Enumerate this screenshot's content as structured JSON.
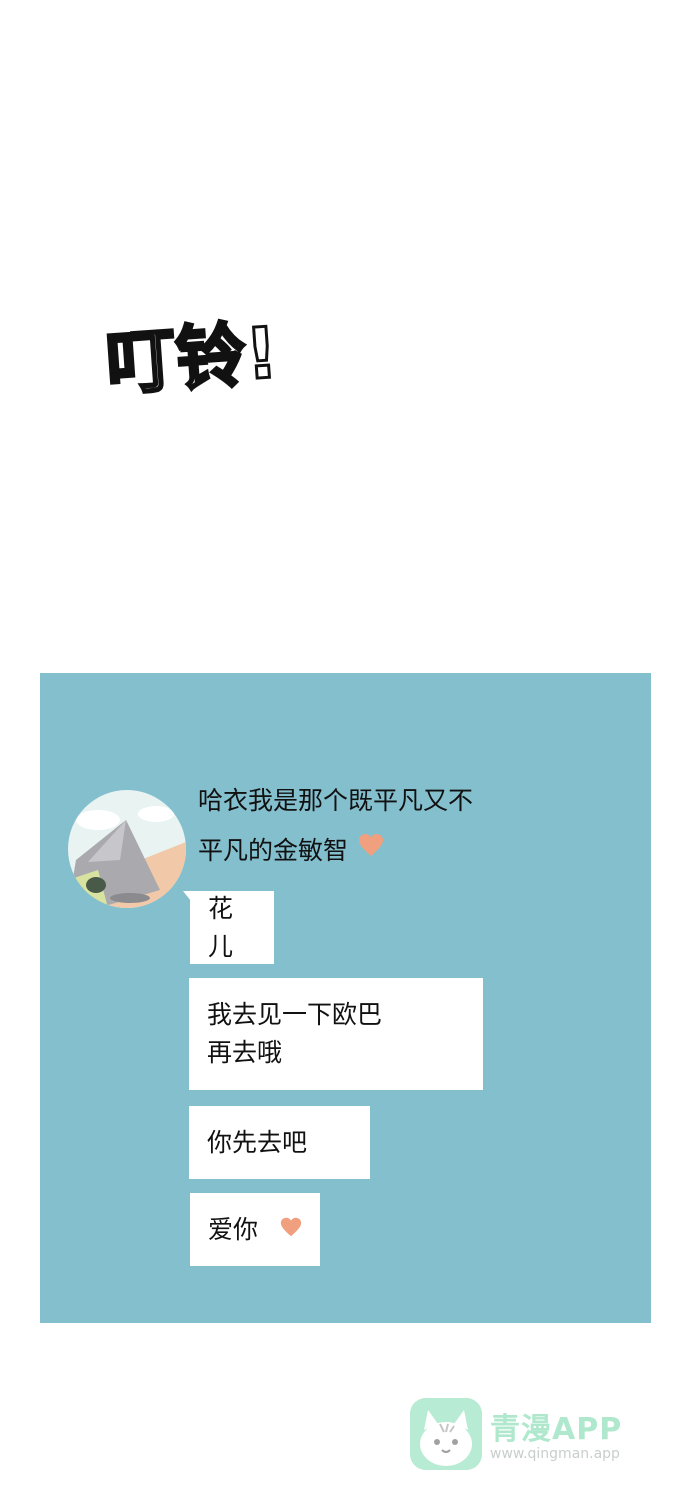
{
  "sound_effect": "叮铃!",
  "chat": {
    "header_lines": [
      "哈衣我是那个既平凡又不",
      "平凡的金敏智"
    ],
    "messages": [
      {
        "text": "花儿"
      },
      {
        "text": "我去见一下欧巴\n再去哦"
      },
      {
        "text": "你先去吧"
      },
      {
        "text": "爱你"
      }
    ]
  },
  "colors": {
    "panel_bg": "#84bfce",
    "bubble_bg": "#ffffff",
    "heart": "#f0a07e"
  },
  "icons": {
    "header_heart": "heart-icon",
    "message_heart": "heart-icon",
    "avatar": "mountain-avatar"
  },
  "watermark": {
    "title": "青漫APP",
    "url": "www.qingman.app"
  }
}
